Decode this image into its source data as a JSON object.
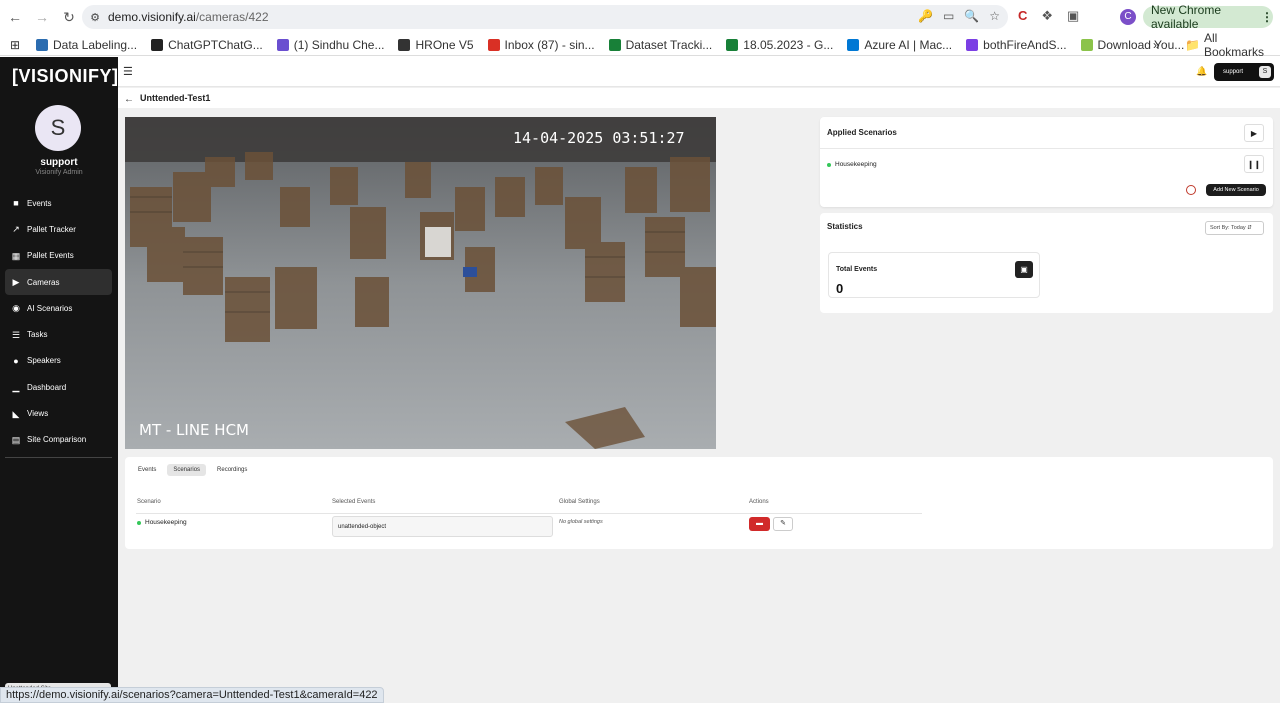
{
  "browser": {
    "url_domain": "demo.visionify.ai",
    "url_path": "/cameras/422",
    "update_label": "New Chrome available",
    "profile_initial": "C",
    "bookmarks": [
      {
        "label": "Data Labeling...",
        "color": "#2b6cb0"
      },
      {
        "label": "ChatGPTChatG...",
        "color": "#222222"
      },
      {
        "label": "(1) Sindhu Che...",
        "color": "#6a4fd0"
      },
      {
        "label": "HROne V5",
        "color": "#333333"
      },
      {
        "label": "Inbox (87) - sin...",
        "color": "#d93025"
      },
      {
        "label": "Dataset Tracki...",
        "color": "#188038"
      },
      {
        "label": "18.05.2023 - G...",
        "color": "#188038"
      },
      {
        "label": "Azure AI | Mac...",
        "color": "#0078d4"
      },
      {
        "label": "bothFireAndS...",
        "color": "#7b3fe4"
      },
      {
        "label": "Download You...",
        "color": "#8bc34a"
      }
    ],
    "all_bookmarks_label": "All Bookmarks",
    "status_url": "https://demo.visionify.ai/scenarios?camera=Unttended-Test1&cameraId=422"
  },
  "sidebar": {
    "logo": "[VISIONIFY]",
    "avatar_initial": "S",
    "user_name": "support",
    "user_role": "Visionify Admin",
    "items": [
      {
        "label": "Events",
        "icon": "events-icon"
      },
      {
        "label": "Pallet Tracker",
        "icon": "chart-icon"
      },
      {
        "label": "Pallet Events",
        "icon": "grid-icon"
      },
      {
        "label": "Cameras",
        "icon": "camera-icon"
      },
      {
        "label": "AI Scenarios",
        "icon": "scenarios-icon"
      },
      {
        "label": "Tasks",
        "icon": "tasks-icon"
      },
      {
        "label": "Speakers",
        "icon": "mic-icon"
      },
      {
        "label": "Dashboard",
        "icon": "bar-chart-icon"
      },
      {
        "label": "Views",
        "icon": "views-icon"
      },
      {
        "label": "Site Comparison",
        "icon": "compare-icon"
      }
    ],
    "active_item": "Cameras",
    "footer_text": "Unattended Site..."
  },
  "header": {
    "user_label": "support",
    "user_initial": "S"
  },
  "page": {
    "title": "Unttended-Test1",
    "video_timestamp": "14-04-2025 03:51:27",
    "video_caption": "MT - LINE HCM"
  },
  "applied_scenarios": {
    "title": "Applied Scenarios",
    "items": [
      {
        "name": "Housekeeping",
        "status_color": "#34c759"
      }
    ],
    "add_button": "Add New Scenario"
  },
  "statistics": {
    "title": "Statistics",
    "sort_label": "Sort By: Today",
    "total_events_label": "Total Events",
    "total_events_value": "0"
  },
  "bottom": {
    "tabs": [
      "Events",
      "Scenarios",
      "Recordings"
    ],
    "active_tab": "Scenarios",
    "columns": [
      "Scenario",
      "Selected Events",
      "Global Settings",
      "Actions"
    ],
    "rows": [
      {
        "scenario": "Housekeeping",
        "selected_events": "unattended-object",
        "global_settings": "No global settings"
      }
    ]
  }
}
